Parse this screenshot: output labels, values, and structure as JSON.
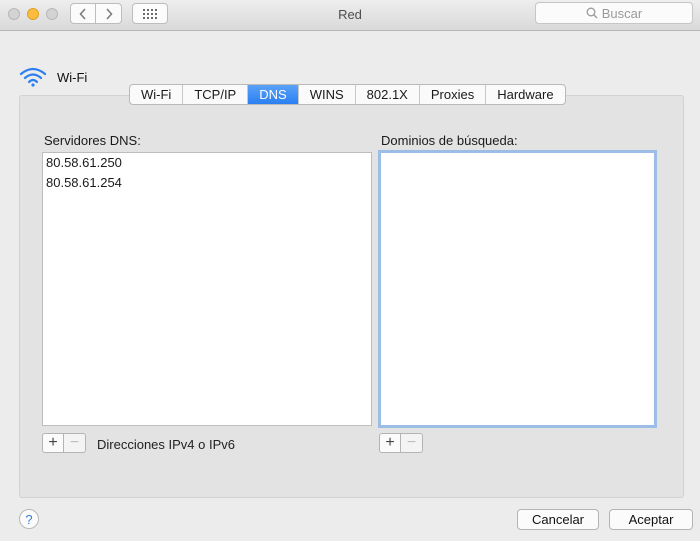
{
  "window": {
    "title": "Red",
    "search_placeholder": "Buscar"
  },
  "interface": {
    "name": "Wi-Fi",
    "icon": "wifi-icon",
    "accent": "#2b7ff3"
  },
  "tabs": [
    {
      "label": "Wi-Fi",
      "active": false
    },
    {
      "label": "TCP/IP",
      "active": false
    },
    {
      "label": "DNS",
      "active": true
    },
    {
      "label": "WINS",
      "active": false
    },
    {
      "label": "802.1X",
      "active": false
    },
    {
      "label": "Proxies",
      "active": false
    },
    {
      "label": "Hardware",
      "active": false
    }
  ],
  "dns": {
    "label": "Servidores DNS:",
    "servers": [
      "80.58.61.250",
      "80.58.61.254"
    ],
    "hint": "Direcciones IPv4 o IPv6",
    "add": "+",
    "remove": "−"
  },
  "search_domains": {
    "label": "Dominios de búsqueda:",
    "items": [],
    "add": "+",
    "remove": "−"
  },
  "footer": {
    "help": "?",
    "cancel": "Cancelar",
    "ok": "Aceptar"
  }
}
